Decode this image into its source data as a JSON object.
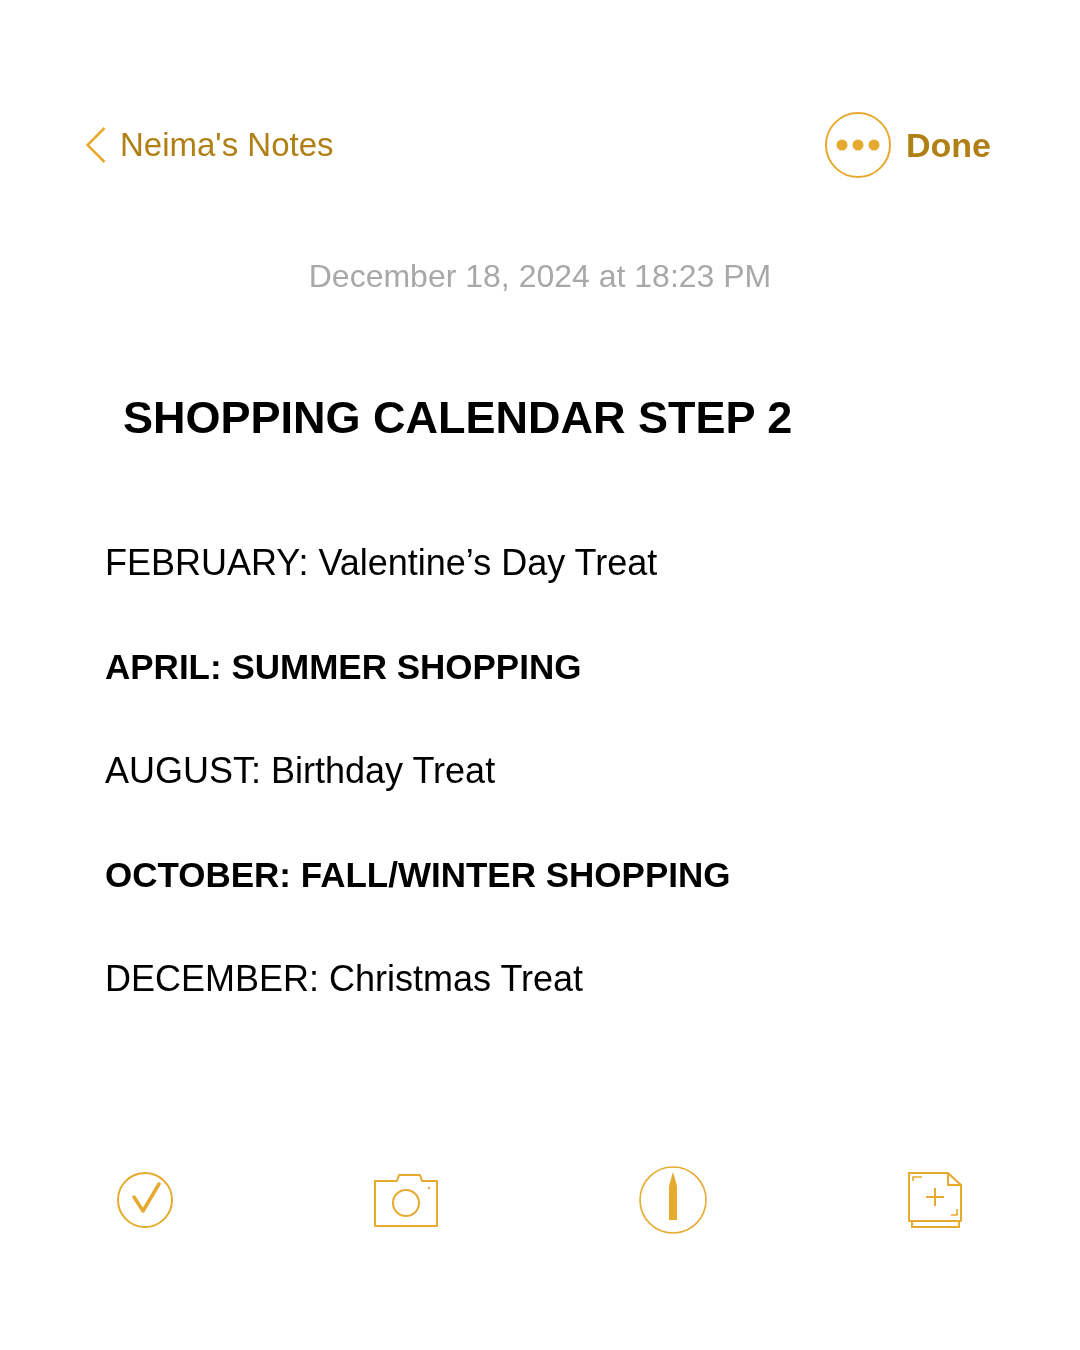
{
  "nav": {
    "back_label": "Neima's Notes",
    "done_label": "Done"
  },
  "note": {
    "timestamp": "December 18, 2024 at 18:23 PM",
    "title": "SHOPPING CALENDAR STEP 2",
    "entries": [
      {
        "text": "FEBRUARY: Valentine’s Day Treat",
        "kind": "regular"
      },
      {
        "text": "APRIL: SUMMER SHOPPING",
        "kind": "heading"
      },
      {
        "text": "AUGUST: Birthday Treat",
        "kind": "regular"
      },
      {
        "text": "OCTOBER: FALL/WINTER SHOPPING",
        "kind": "heading"
      },
      {
        "text": "DECEMBER: Christmas Treat",
        "kind": "regular"
      }
    ]
  }
}
